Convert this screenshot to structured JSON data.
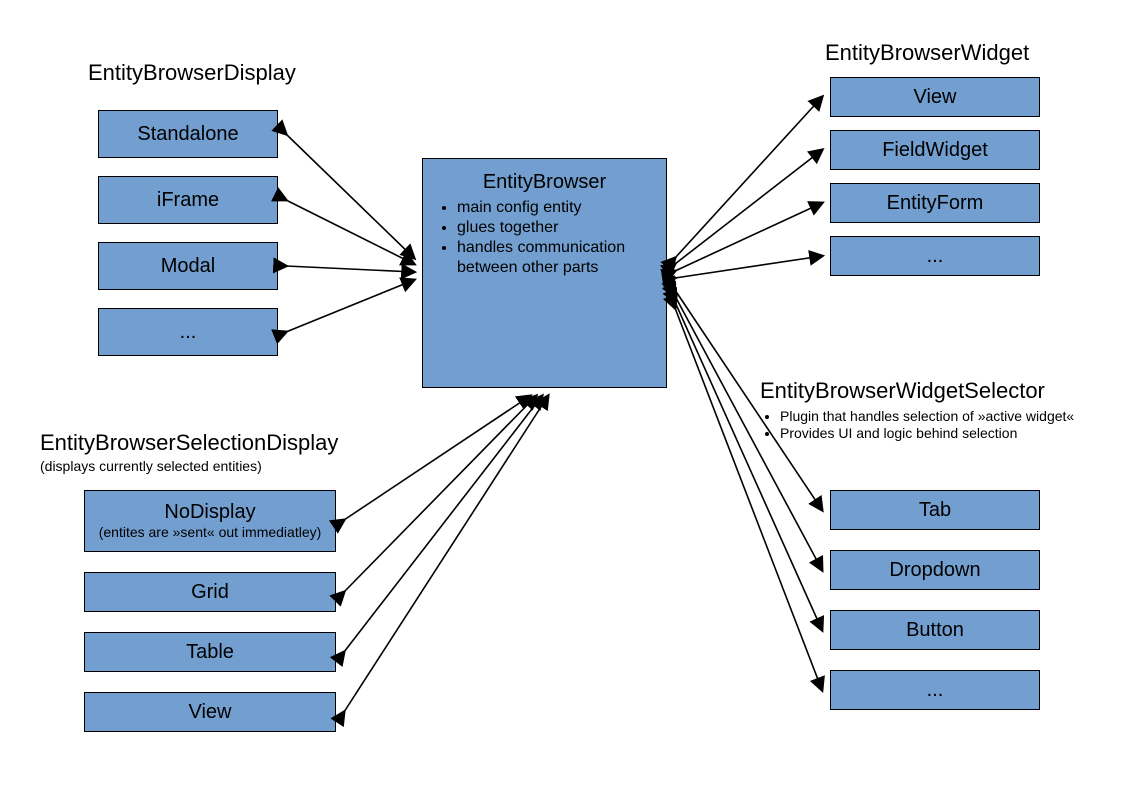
{
  "center": {
    "title": "EntityBrowser",
    "bullets": [
      "main config entity",
      "glues together",
      "handles communication between other parts"
    ]
  },
  "display": {
    "heading": "EntityBrowserDisplay",
    "items": [
      "Standalone",
      "iFrame",
      "Modal",
      "..."
    ]
  },
  "widget": {
    "heading": "EntityBrowserWidget",
    "items": [
      "View",
      "FieldWidget",
      "EntityForm",
      "..."
    ]
  },
  "selection": {
    "heading": "EntityBrowserSelectionDisplay",
    "subheading": "(displays currently selected entities)",
    "items": [
      {
        "label": "NoDisplay",
        "sub": "(entites are »sent« out immediatley)"
      },
      {
        "label": "Grid"
      },
      {
        "label": "Table"
      },
      {
        "label": "View"
      }
    ]
  },
  "widgetSelector": {
    "heading": "EntityBrowserWidgetSelector",
    "bullets": [
      "Plugin that handles selection of »active widget«",
      "Provides UI and logic behind selection"
    ],
    "items": [
      "Tab",
      "Dropdown",
      "Button",
      "..."
    ]
  }
}
